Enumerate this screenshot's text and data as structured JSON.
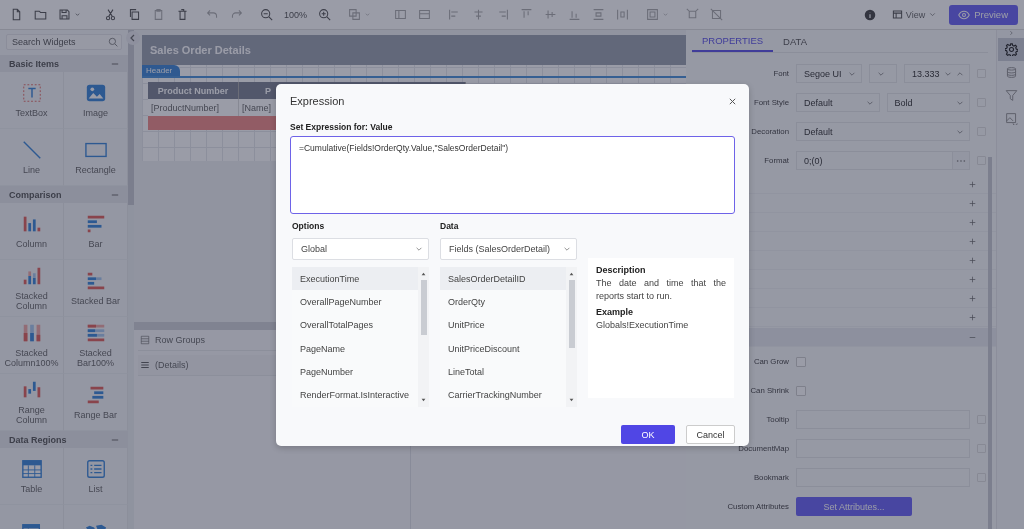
{
  "toolbar": {
    "zoom": "100%",
    "view": "View",
    "preview": "Preview"
  },
  "sidebar": {
    "search_placeholder": "Search Widgets",
    "sections": [
      {
        "title": "Basic Items",
        "expanded": true,
        "items": [
          {
            "kind": "textbox",
            "label": "TextBox"
          },
          {
            "kind": "image",
            "label": "Image"
          },
          {
            "kind": "line",
            "label": "Line"
          },
          {
            "kind": "rectangle",
            "label": "Rectangle"
          }
        ]
      },
      {
        "title": "Comparison",
        "expanded": true,
        "items": [
          {
            "kind": "column",
            "label": "Column"
          },
          {
            "kind": "bar",
            "label": "Bar"
          },
          {
            "kind": "stacked-column",
            "label": "Stacked Column"
          },
          {
            "kind": "stacked-bar",
            "label": "Stacked Bar"
          },
          {
            "kind": "column100",
            "label": "Stacked Column100%"
          },
          {
            "kind": "bar100",
            "label": "Stacked Bar100%"
          },
          {
            "kind": "range-column",
            "label": "Range Column"
          },
          {
            "kind": "range-bar",
            "label": "Range Bar"
          }
        ]
      },
      {
        "title": "Data Regions",
        "expanded": true,
        "items": [
          {
            "kind": "table",
            "label": "Table"
          },
          {
            "kind": "list",
            "label": "List"
          },
          {
            "kind": "matrix"
          },
          {
            "kind": "map"
          }
        ]
      }
    ]
  },
  "report": {
    "title": "Sales Order Details",
    "band": "Header",
    "columns": [
      "Product Number",
      "P"
    ],
    "cells": [
      "[ProductNumber]",
      "[Name]"
    ]
  },
  "row_groups": {
    "title": "Row Groups",
    "items": [
      "(Details)"
    ]
  },
  "properties": {
    "tabs": [
      {
        "label": "PROPERTIES",
        "selected": true
      },
      {
        "label": "DATA",
        "selected": false
      }
    ],
    "rows": [
      {
        "kind": "font",
        "label": "Font",
        "family": "Segoe UI",
        "size": "13.333"
      },
      {
        "kind": "dual-select",
        "label": "Font Style",
        "values": [
          "Default",
          "Bold"
        ]
      },
      {
        "kind": "select",
        "label": "Decoration",
        "value": "Default"
      },
      {
        "kind": "format",
        "label": "Format",
        "value": "0;(0)"
      },
      {
        "kind": "group",
        "expanded": false
      },
      {
        "kind": "group",
        "expanded": false
      },
      {
        "kind": "group",
        "expanded": false
      },
      {
        "kind": "group",
        "expanded": false
      },
      {
        "kind": "group",
        "expanded": false
      },
      {
        "kind": "group",
        "expanded": false
      },
      {
        "kind": "group",
        "expanded": false
      },
      {
        "kind": "group",
        "expanded": false
      },
      {
        "kind": "section",
        "expanded": true
      },
      {
        "kind": "checkbox",
        "label": "Can Grow",
        "checked": false
      },
      {
        "kind": "checkbox",
        "label": "Can Shrink",
        "checked": false
      },
      {
        "kind": "text",
        "label": "Tooltip"
      },
      {
        "kind": "text",
        "label": "DocumentMap"
      },
      {
        "kind": "text",
        "label": "Bookmark"
      },
      {
        "kind": "button",
        "label": "Custom Attributes",
        "value": "Set Attributes..."
      }
    ]
  },
  "side_icons": [
    {
      "kind": "settings",
      "selected": true
    },
    {
      "kind": "database",
      "selected": false
    },
    {
      "kind": "filter",
      "selected": false
    },
    {
      "kind": "image",
      "selected": false
    }
  ],
  "dialog": {
    "title": "Expression",
    "heading": "Set Expression for: Value",
    "expression": "=Cumulative(Fields!OrderQty.Value,\"SalesOrderDetail\")",
    "options": {
      "label": "Options",
      "value": "Global",
      "items": [
        {
          "label": "ExecutionTime",
          "selected": true
        },
        {
          "label": "OverallPageNumber",
          "selected": false
        },
        {
          "label": "OverallTotalPages",
          "selected": false
        },
        {
          "label": "PageName",
          "selected": false
        },
        {
          "label": "PageNumber",
          "selected": false
        },
        {
          "label": "RenderFormat.IsInteractive",
          "selected": false
        }
      ]
    },
    "data": {
      "label": "Data",
      "value": "Fields (SalesOrderDetail)",
      "items": [
        {
          "label": "SalesOrderDetailID",
          "selected": true
        },
        {
          "label": "OrderQty",
          "selected": false
        },
        {
          "label": "UnitPrice",
          "selected": false
        },
        {
          "label": "UnitPriceDiscount",
          "selected": false
        },
        {
          "label": "LineTotal",
          "selected": false
        },
        {
          "label": "CarrierTrackingNumber",
          "selected": false
        }
      ]
    },
    "description": {
      "title": "Description",
      "text": "The date and time that the reports start to run.",
      "example_title": "Example",
      "example": "Globals!ExecutionTime"
    },
    "buttons": [
      {
        "label": "OK",
        "kind": "primary"
      },
      {
        "label": "Cancel",
        "kind": "secondary"
      }
    ]
  }
}
